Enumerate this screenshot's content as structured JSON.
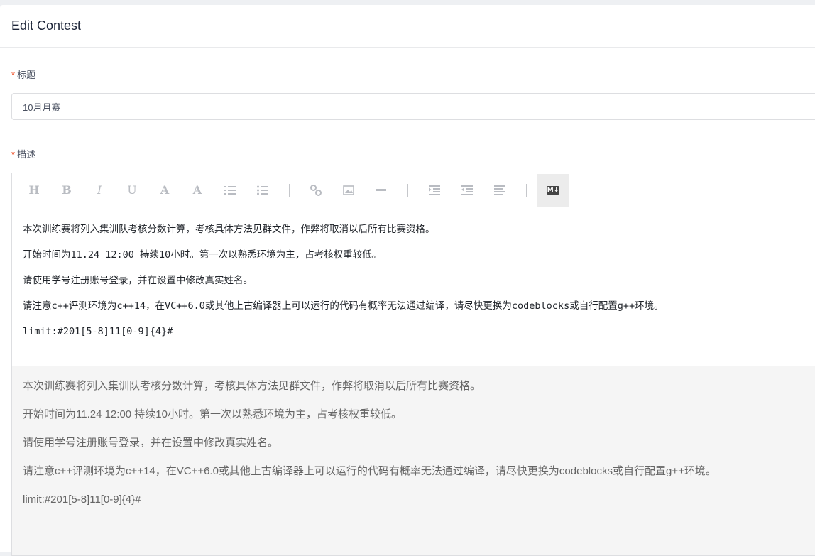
{
  "header": {
    "title": "Edit Contest"
  },
  "form": {
    "title_field": {
      "required_mark": "*",
      "label": "标题",
      "value": "10月月赛"
    },
    "description_field": {
      "required_mark": "*",
      "label": "描述"
    }
  },
  "editor": {
    "toolbar": [
      {
        "name": "heading-icon",
        "glyph": "H"
      },
      {
        "name": "bold-icon",
        "glyph": "B"
      },
      {
        "name": "italic-icon",
        "glyph": "I"
      },
      {
        "name": "underline-icon",
        "glyph": "U"
      },
      {
        "name": "font-size-icon",
        "glyph": "A"
      },
      {
        "name": "font-color-icon",
        "glyph": "A"
      },
      {
        "name": "ordered-list-icon",
        "glyph": ""
      },
      {
        "name": "unordered-list-icon",
        "glyph": ""
      },
      {
        "name": "link-icon",
        "glyph": ""
      },
      {
        "name": "image-icon",
        "glyph": ""
      },
      {
        "name": "horizontal-rule-icon",
        "glyph": ""
      },
      {
        "name": "indent-icon",
        "glyph": ""
      },
      {
        "name": "outdent-icon",
        "glyph": ""
      },
      {
        "name": "align-icon",
        "glyph": ""
      },
      {
        "name": "markdown-toggle-icon",
        "glyph": "M↓"
      }
    ],
    "source_lines": [
      "本次训练赛将列入集训队考核分数计算，考核具体方法见群文件，作弊将取消以后所有比赛资格。",
      "开始时间为11.24 12:00 持续10小时。第一次以熟悉环境为主，占考核权重较低。",
      "请使用学号注册账号登录，并在设置中修改真实姓名。",
      "请注意c++评测环境为c++14，在VC++6.0或其他上古编译器上可以运行的代码有概率无法通过编译，请尽快更换为codeblocks或自行配置g++环境。",
      "limit:#201[5-8]11[0-9]{4}#"
    ],
    "preview_lines": [
      "本次训练赛将列入集训队考核分数计算，考核具体方法见群文件，作弊将取消以后所有比赛资格。",
      "开始时间为11.24 12:00 持续10小时。第一次以熟悉环境为主，占考核权重较低。",
      "请使用学号注册账号登录，并在设置中修改真实姓名。",
      "请注意c++评测环境为c++14，在VC++6.0或其他上古编译器上可以运行的代码有概率无法通过编译，请尽快更换为codeblocks或自行配置g++环境。",
      "limit:#201[5-8]11[0-9]{4}#"
    ]
  }
}
